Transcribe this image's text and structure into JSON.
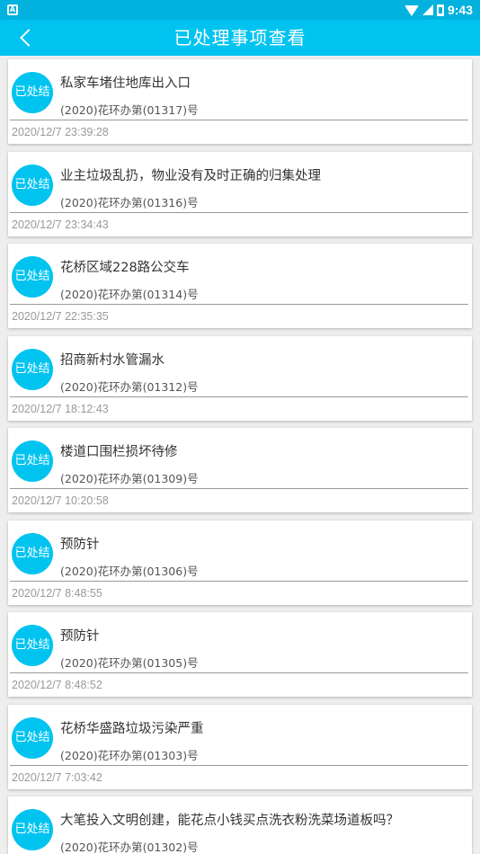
{
  "status_bar": {
    "time": "9:43",
    "left_icon": "A"
  },
  "header": {
    "title": "已处理事项查看",
    "back_icon": "chevron-left-icon"
  },
  "colors": {
    "accent": "#00c3f0",
    "status_bar": "#00b2dd"
  },
  "items": [
    {
      "badge": "已处结",
      "title": "私家车堵住地库出入口",
      "number": "(2020)花环办第(01317)号",
      "time": "2020/12/7 23:39:28"
    },
    {
      "badge": "已处结",
      "title": "业主垃圾乱扔，物业没有及时正确的归集处理",
      "number": "(2020)花环办第(01316)号",
      "time": "2020/12/7 23:34:43"
    },
    {
      "badge": "已处结",
      "title": "花桥区域228路公交车",
      "number": "(2020)花环办第(01314)号",
      "time": "2020/12/7 22:35:35"
    },
    {
      "badge": "已处结",
      "title": "招商新村水管漏水",
      "number": "(2020)花环办第(01312)号",
      "time": "2020/12/7 18:12:43"
    },
    {
      "badge": "已处结",
      "title": "楼道口围栏损坏待修",
      "number": "(2020)花环办第(01309)号",
      "time": "2020/12/7 10:20:58"
    },
    {
      "badge": "已处结",
      "title": "预防针",
      "number": "(2020)花环办第(01306)号",
      "time": "2020/12/7 8:48:55"
    },
    {
      "badge": "已处结",
      "title": "预防针",
      "number": "(2020)花环办第(01305)号",
      "time": "2020/12/7 8:48:52"
    },
    {
      "badge": "已处结",
      "title": "花桥华盛路垃圾污染严重",
      "number": "(2020)花环办第(01303)号",
      "time": "2020/12/7 7:03:42"
    },
    {
      "badge": "已处结",
      "title": "大笔投入文明创建，能花点小钱买点洗衣粉洗菜场道板吗？",
      "number": "(2020)花环办第(01302)号",
      "time": ""
    }
  ]
}
